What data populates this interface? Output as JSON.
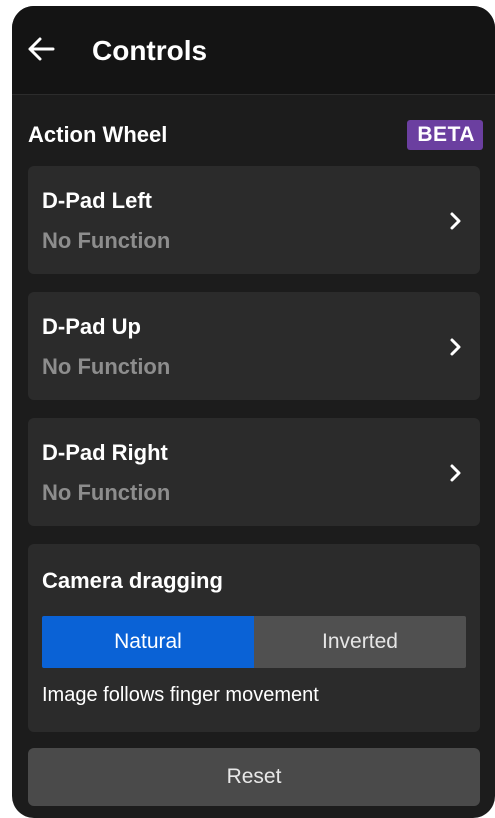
{
  "header": {
    "title": "Controls",
    "back_icon": "arrow-left-icon"
  },
  "action_wheel": {
    "title": "Action Wheel",
    "badge": "BETA",
    "badge_color": "#6b3fa0",
    "items": [
      {
        "name": "D-Pad Left",
        "value": "No Function"
      },
      {
        "name": "D-Pad Up",
        "value": "No Function"
      },
      {
        "name": "D-Pad Right",
        "value": "No Function"
      }
    ]
  },
  "camera": {
    "title": "Camera dragging",
    "options": [
      "Natural",
      "Inverted"
    ],
    "selected": "Natural",
    "selected_color": "#0a62d6",
    "description": "Image follows finger movement"
  },
  "reset_label": "Reset"
}
